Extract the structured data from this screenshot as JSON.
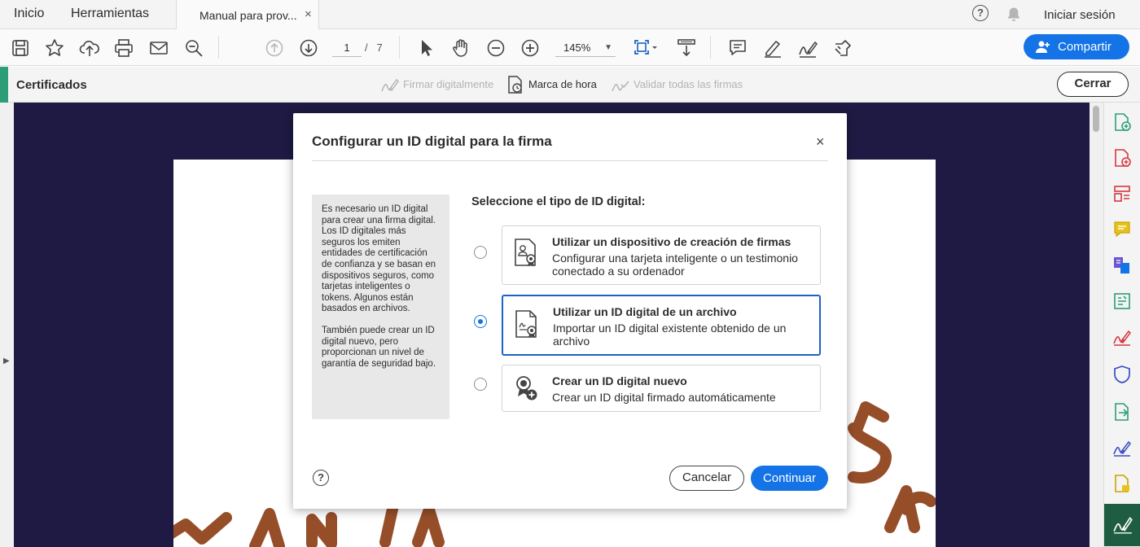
{
  "topnav": {
    "home_label": "Inicio",
    "tools_label": "Herramientas",
    "doc_tab_title": "Manual para prov...",
    "tab_close": "×",
    "help_glyph": "?",
    "signin_label": "Iniciar sesión"
  },
  "toolbar": {
    "current_page": "1",
    "page_separator": "/",
    "total_pages": "7",
    "zoom_value": "145%",
    "share_label": "Compartir"
  },
  "certbar": {
    "title": "Certificados",
    "sign_digitally": "Firmar digitalmente",
    "timestamp": "Marca de hora",
    "validate_all": "Validar todas las firmas",
    "close_label": "Cerrar"
  },
  "dialog": {
    "title": "Configurar un ID digital para la firma",
    "close_glyph": "×",
    "info_paragraph_1": "Es necesario un ID digital para crear una firma digital. Los ID digitales más seguros los emiten entidades de certificación de confianza y se basan en dispositivos seguros, como tarjetas inteligentes o tokens. Algunos están basados en archivos.",
    "info_paragraph_2": "También puede crear un ID digital nuevo, pero proporcionan un nivel de garantía de seguridad bajo.",
    "select_label": "Seleccione el tipo de ID digital:",
    "options": [
      {
        "title": "Utilizar un dispositivo de creación de firmas",
        "description": "Configurar una tarjeta inteligente o un testimonio conectado a su ordenador",
        "selected": false
      },
      {
        "title": "Utilizar un ID digital de un archivo",
        "description": "Importar un ID digital existente obtenido de un archivo",
        "selected": true
      },
      {
        "title": "Crear un ID digital nuevo",
        "description": "Crear un ID digital firmado automáticamente",
        "selected": false
      }
    ],
    "help_glyph": "?",
    "cancel_label": "Cancelar",
    "continue_label": "Continuar"
  },
  "colors": {
    "accent_blue": "#1473e6",
    "selected_border": "#1b63c6",
    "cert_accent": "#2d9d78",
    "document_background": "#1e1a44",
    "doc_lettering": "#8b3b12"
  },
  "icons": {
    "toolbar": [
      "save-icon",
      "star-icon",
      "cloud-upload-icon",
      "print-icon",
      "mail-icon",
      "zoom-search-icon",
      "page-up-icon",
      "page-down-icon",
      "select-pointer-icon",
      "hand-icon",
      "zoom-out-icon",
      "zoom-in-icon",
      "fit-page-icon",
      "scroll-mode-icon",
      "comment-icon",
      "highlight-pen-icon",
      "fill-sign-icon",
      "more-tools-icon"
    ],
    "rightpanel": [
      "create-pdf-icon",
      "export-pdf-icon",
      "organize-pages-icon",
      "comment-icon",
      "combine-files-icon",
      "edit-pdf-icon",
      "fill-sign-icon",
      "protect-icon",
      "send-review-icon",
      "request-signature-icon",
      "scan-icon",
      "certificates-icon"
    ]
  }
}
